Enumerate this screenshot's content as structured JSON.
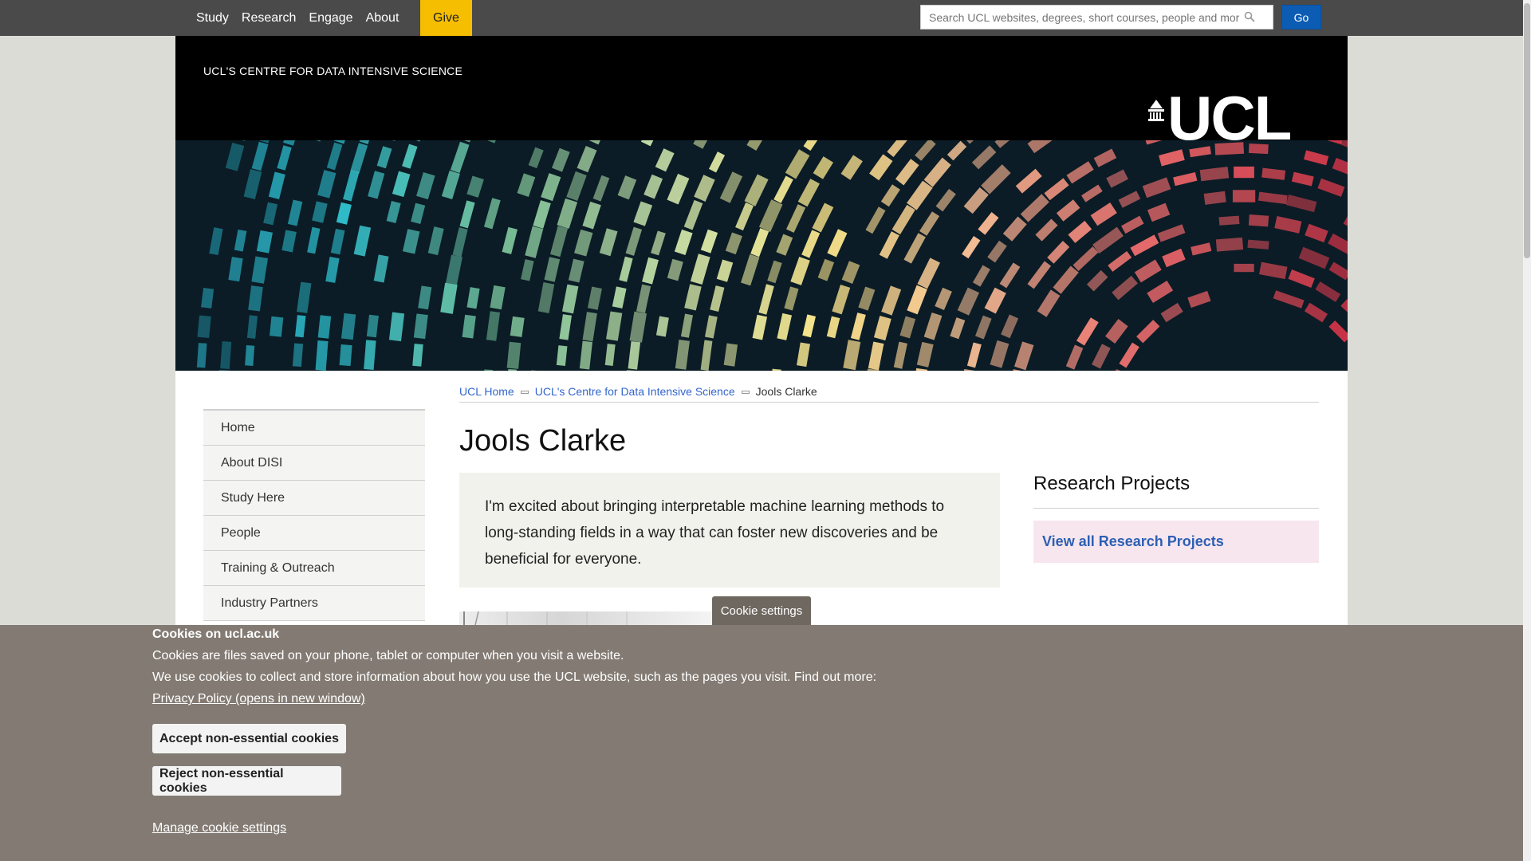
{
  "topnav": {
    "items": [
      "Study",
      "Research",
      "Engage",
      "About"
    ],
    "give_label": "Give",
    "search_placeholder": "Search UCL websites, degrees, short courses, people and more",
    "go_label": "Go"
  },
  "header": {
    "site_title": "UCL'S CENTRE FOR DATA INTENSIVE SCIENCE",
    "logo_text": "UCL"
  },
  "leftnav": {
    "items": [
      "Home",
      "About DISI",
      "Study Here",
      "People",
      "Training & Outreach",
      "Industry Partners"
    ]
  },
  "breadcrumb": {
    "home": "UCL Home",
    "section": "UCL's Centre for Data Intensive Science",
    "current": "Jools Clarke"
  },
  "main": {
    "title": "Jools Clarke",
    "quote": "I'm excited about bringing interpretable machine learning methods to long-standing fields in a way that can foster new discoveries and be beneficial for everyone."
  },
  "sidebar": {
    "title": "Research Projects",
    "link_label": "View all Research Projects"
  },
  "cookie": {
    "tab_label": "Cookie settings",
    "title": "Cookies on ucl.ac.uk",
    "line1": "Cookies are files saved on your phone, tablet or computer when you visit a website.",
    "line2": "We use cookies to collect and store information about how you use the UCL website, such as the pages you visit. Find out more:",
    "privacy_link": "Privacy Policy (opens in new window)",
    "accept_label": "Accept non-essential cookies",
    "reject_label": "Reject non-essential cookies",
    "manage_label": "Manage cookie settings"
  },
  "colors": {
    "topbar": "#4a4a4a",
    "give": "#f6be00",
    "go_button": "#0c5cb4",
    "link": "#3366cc",
    "cookie_banner": "#837b73"
  }
}
